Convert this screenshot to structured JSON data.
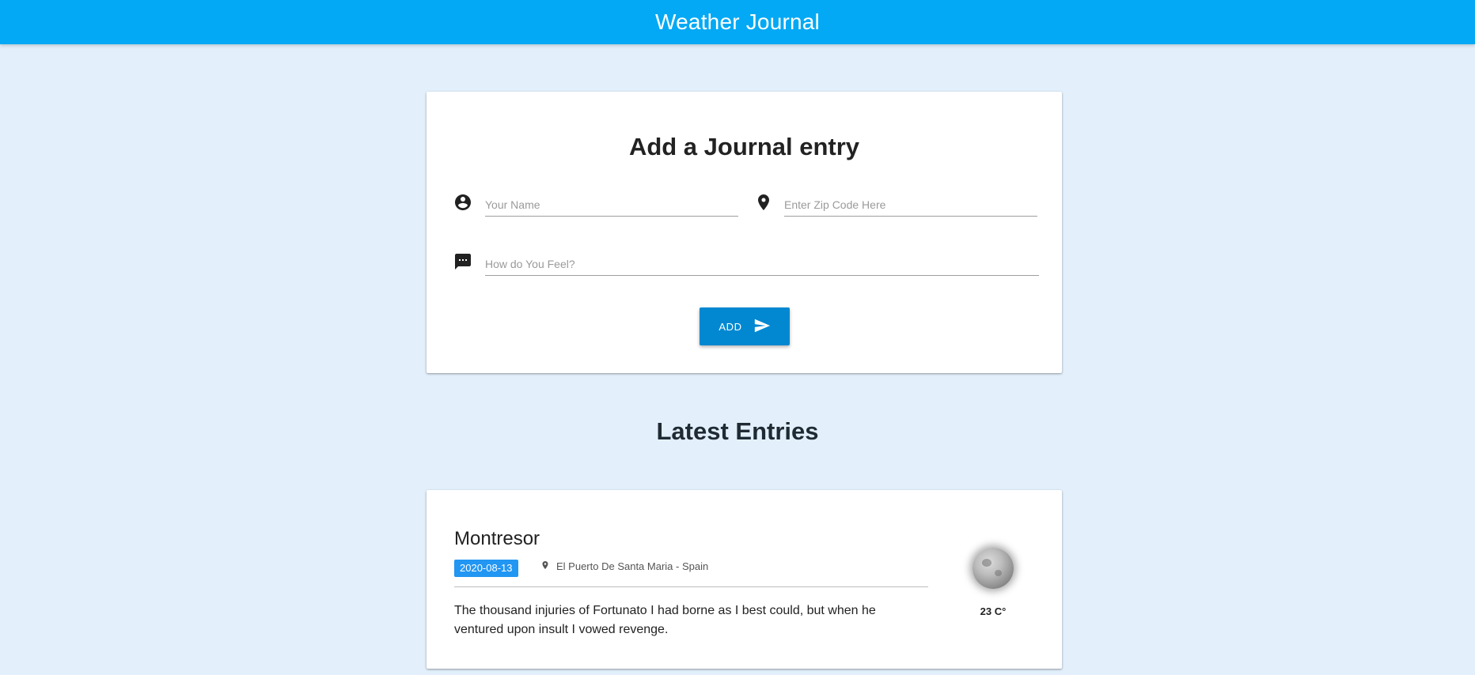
{
  "header": {
    "title": "Weather Journal"
  },
  "form": {
    "title": "Add a Journal entry",
    "name_placeholder": "Your Name",
    "zip_placeholder": "Enter Zip Code Here",
    "feel_placeholder": "How do You Feel?",
    "add_label": "ADD",
    "icons": {
      "name": "account-circle-icon",
      "zip": "location-pin-icon",
      "feel": "chat-bubble-icon",
      "add": "send-icon"
    }
  },
  "latest": {
    "title": "Latest Entries",
    "entries": [
      {
        "name": "Montresor",
        "date": "2020-08-13",
        "location": "El Puerto De Santa Maria - Spain",
        "text": "The thousand injuries of Fortunato I had borne as I best could, but when he ventured upon insult I vowed revenge.",
        "weather_icon": "moon-icon",
        "temperature": "23 C°"
      }
    ]
  },
  "colors": {
    "header": "#03a9f4",
    "background": "#e3f0fc",
    "button": "#0288d1",
    "badge": "#2196f3"
  }
}
